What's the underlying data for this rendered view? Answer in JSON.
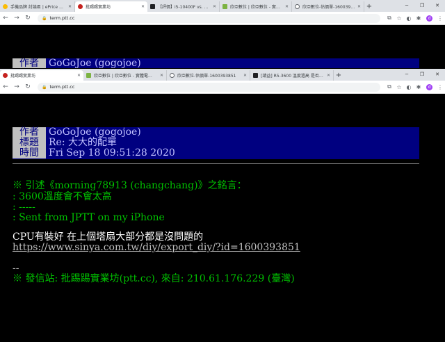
{
  "back_browser": {
    "tabs": [
      {
        "title": "手機品牌 討論區 | ePrice 比…",
        "color": "#fbbc04"
      },
      {
        "title": "批踢踢實業坊",
        "color": "#c5221f",
        "active": true
      },
      {
        "title": "【評價】i5-10400F vs. R5-…",
        "color": "#202124"
      },
      {
        "title": "欣亞數位 | 欣亞數位 - 實…",
        "color": "#7cb342"
      },
      {
        "title": "欣亞數位-估價單-1600393…",
        "color": "#5f6368"
      }
    ],
    "url": "term.ptt.cc"
  },
  "front_browser": {
    "tabs": [
      {
        "title": "批踢踢實業坊",
        "color": "#c5221f",
        "active": true
      },
      {
        "title": "欣亞數位 | 欣亞數位 - 實體電…",
        "color": "#7cb342"
      },
      {
        "title": "欣亞數位-估價單-1600393851",
        "color": "#5f6368"
      },
      {
        "title": "[請益] R5-3600 溫度過高 是否需…",
        "color": "#202124"
      }
    ],
    "url": "term.ptt.cc"
  },
  "back_header": {
    "author_label": "作者",
    "author": "GoGoJoe (gogojoe)"
  },
  "post": {
    "author_label": "作者",
    "author": "GoGoJoe (gogojoe)",
    "title_label": "標題",
    "title": "Re: 大大的配單",
    "time_label": "時間",
    "time": "Fri Sep 18 09:51:28 2020",
    "quote_head": "※ 引述《morning78913 (changchang)》之銘言：",
    "quote_1": ": 3600溫度會不會太高",
    "quote_2": ": -----",
    "quote_3": ": Sent from JPTT on my iPhone",
    "body_1": "CPU有裝好 在上個塔扇大部分都是沒問題的",
    "link": "https://www.sinya.com.tw/diy/export_diy/?id=1600393851",
    "sig_dash": "--",
    "footer": "※ 發信站: 批踢踢實業坊(ptt.cc), 來自: 210.61.176.229 (臺灣)"
  }
}
